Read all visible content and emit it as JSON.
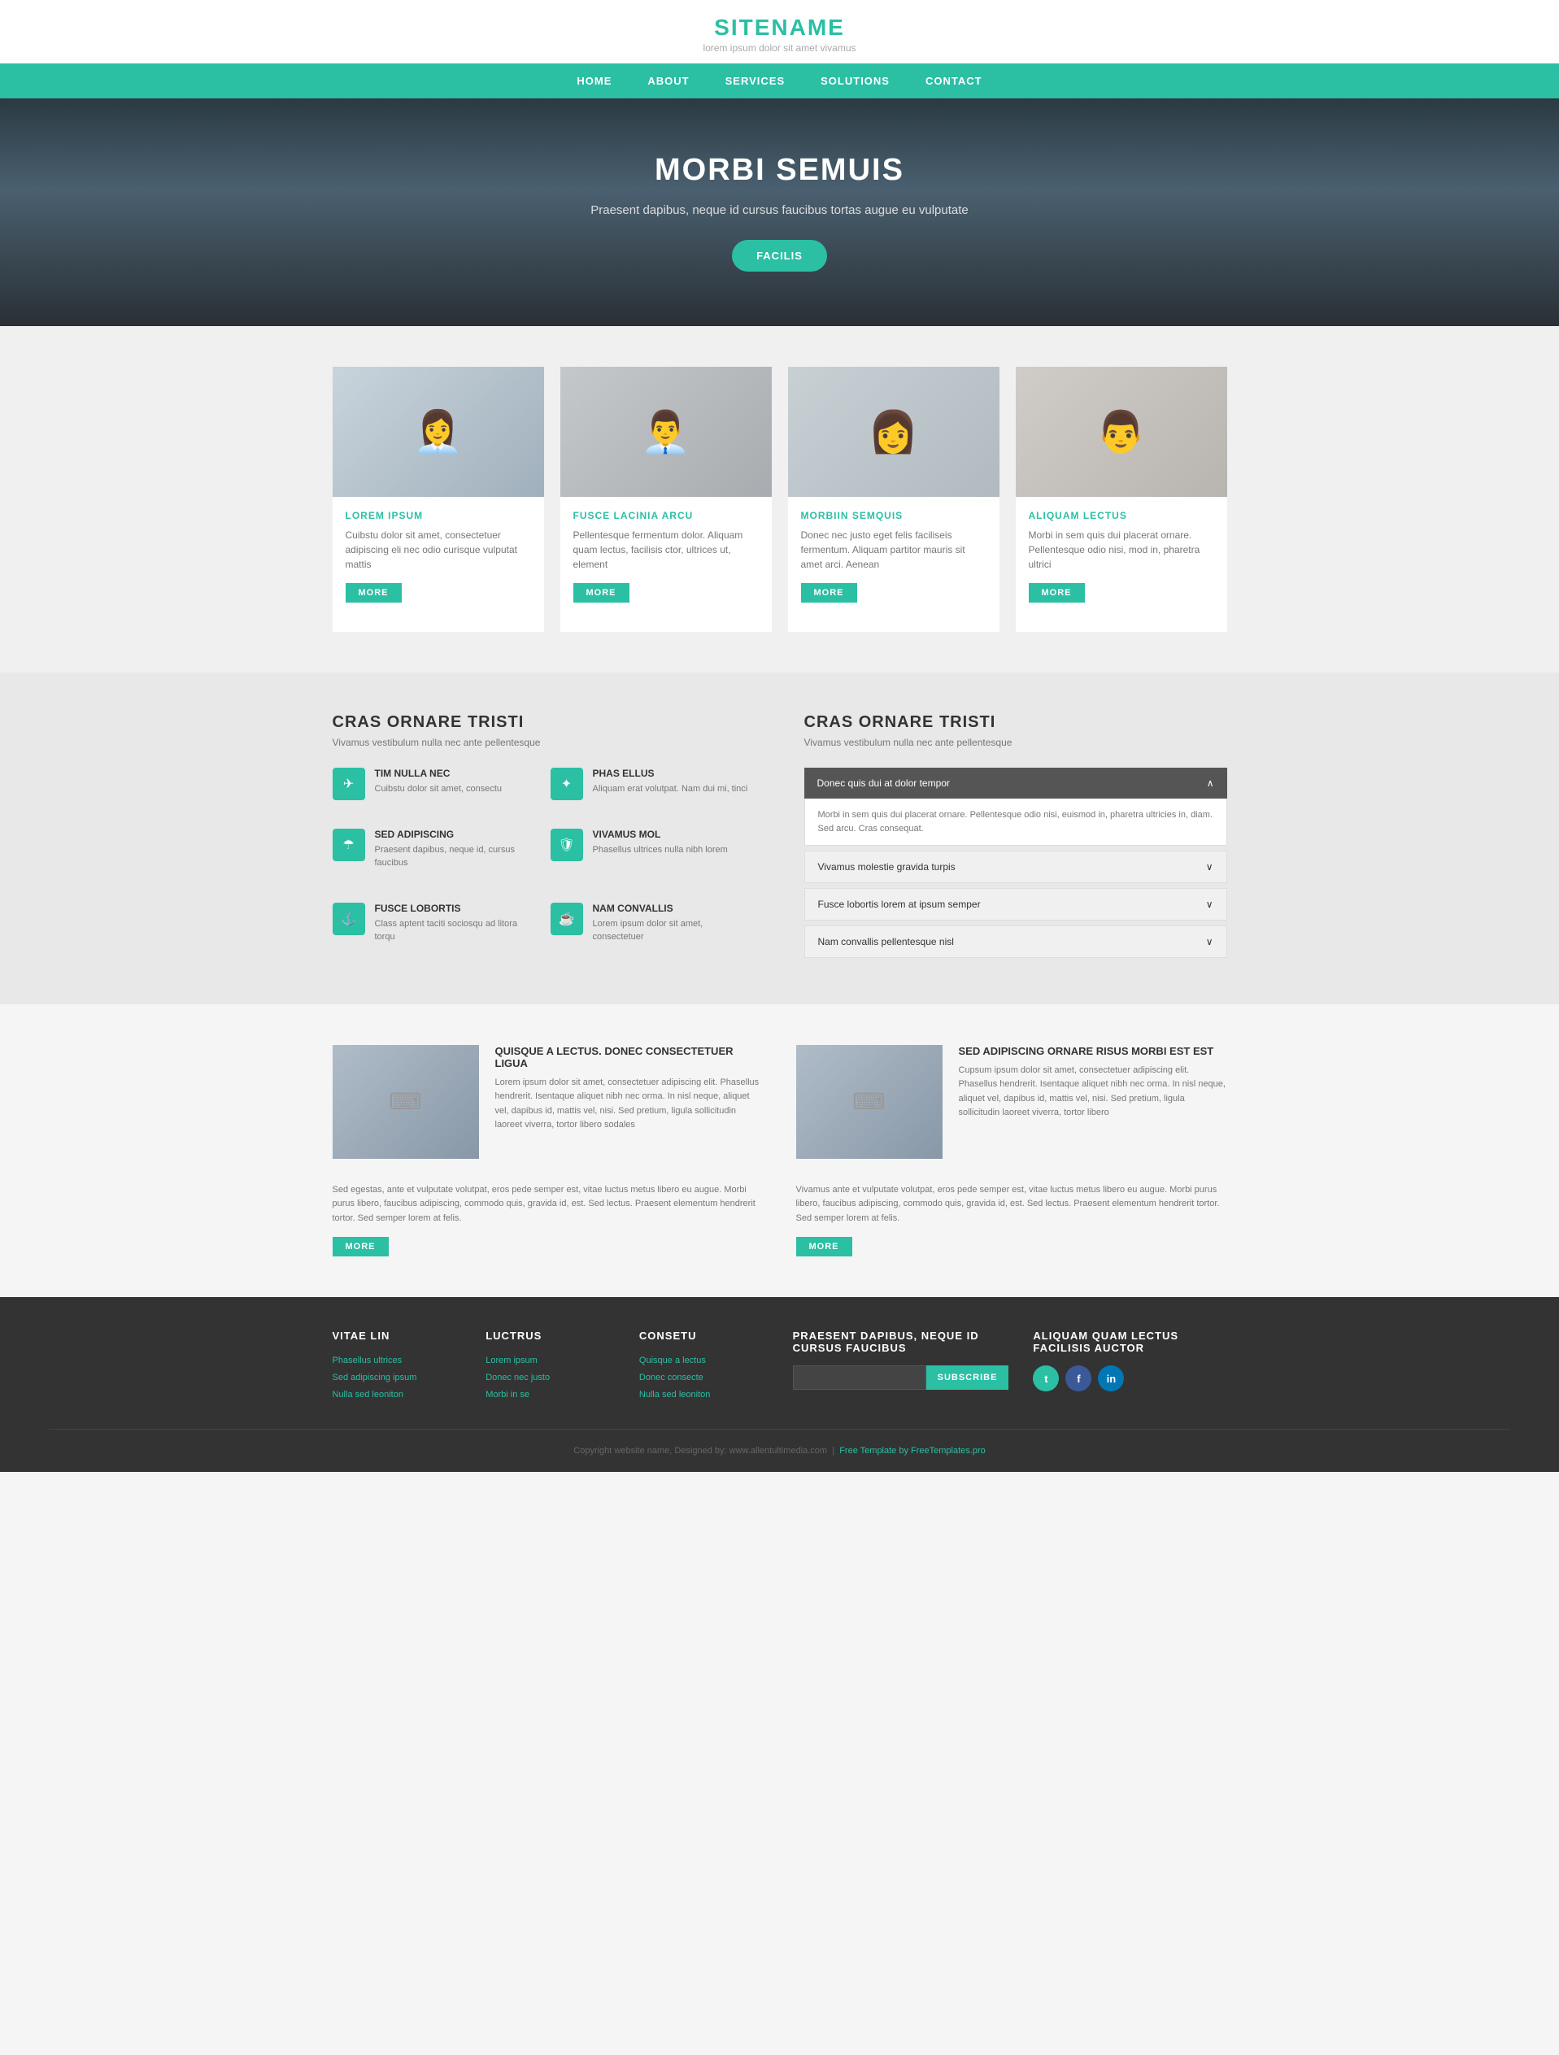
{
  "header": {
    "title": "SITENAME",
    "tagline": "lorem ipsum dolor sit amet vivamus"
  },
  "nav": {
    "items": [
      {
        "label": "HOME",
        "href": "#"
      },
      {
        "label": "ABOUT",
        "href": "#"
      },
      {
        "label": "SERVICES",
        "href": "#"
      },
      {
        "label": "SOLUTIONS",
        "href": "#"
      },
      {
        "label": "CONTACT",
        "href": "#"
      }
    ]
  },
  "hero": {
    "heading": "MORBI SEMUIS",
    "subtext": "Praesent dapibus, neque id cursus faucibus tortas augue eu vulputate",
    "button_label": "FACILIS"
  },
  "cards": {
    "items": [
      {
        "title": "LOREM IPSUM",
        "text": "Cuibstu dolor sit amet, consectetuer adipiscing eli nec odio curisque vulputat mattis",
        "button": "MORE"
      },
      {
        "title": "FUSCE LACINIA ARCU",
        "text": "Pellentesque fermentum dolor. Aliquam quam lectus, facilisis ctor, ultrices ut, element",
        "button": "MORE"
      },
      {
        "title": "MORBIIN SEMQUIS",
        "text": "Donec nec justo eget felis faciliseis fermentum. Aliquam partitor mauris sit amet arci. Aenean",
        "button": "MORE"
      },
      {
        "title": "ALIQUAM LECTUS",
        "text": "Morbi in sem quis dui placerat ornare. Pellentesque odio nisi, mod in, pharetra ultrici",
        "button": "MORE"
      }
    ]
  },
  "features": {
    "left": {
      "heading": "CRAS ORNARE TRISTI",
      "subtext": "Vivamus vestibulum nulla nec ante pellentesque",
      "items": [
        {
          "icon": "✈",
          "title": "TIM NULLA NEC",
          "text": "Cuibstu dolor sit amet, consectu"
        },
        {
          "icon": "✦",
          "title": "PHAS ELLUS",
          "text": "Aliquam erat volutpat. Nam dui mi, tinci"
        },
        {
          "icon": "☂",
          "title": "SED ADIPISCING",
          "text": "Praesent dapibus, neque id, cursus faucibus"
        },
        {
          "icon": "🛡",
          "title": "VIVAMUS MOL",
          "text": "Phasellus ultrices nulla nibh lorem"
        },
        {
          "icon": "⚓",
          "title": "FUSCE LOBORTIS",
          "text": "Class aptent taciti sociosqu ad litora torqu"
        },
        {
          "icon": "☕",
          "title": "NAM CONVALLIS",
          "text": "Lorem ipsum dolor sit amet, consectetuer"
        }
      ]
    },
    "right": {
      "heading": "CRAS ORNARE TRISTI",
      "subtext": "Vivamus vestibulum nulla nec ante pellentesque",
      "accordion": [
        {
          "title": "Donec quis dui at dolor tempor",
          "body": "Morbi in sem quis dui placerat ornare. Pellentesque odio nisi, euismod in, pharetra ultricies in, diam. Sed arcu. Cras consequat.",
          "open": true
        },
        {
          "title": "Vivamus molestie gravida turpis",
          "body": "",
          "open": false
        },
        {
          "title": "Fusce lobortis lorem at ipsum semper",
          "body": "",
          "open": false
        },
        {
          "title": "Nam convallis pellentesque nisl",
          "body": "",
          "open": false
        }
      ]
    }
  },
  "content": {
    "blocks": [
      {
        "title": "QUISQUE A LECTUS. DONEC CONSECTETUER LIGUA",
        "text": "Lorem ipsum dolor sit amet, consectetuer adipiscing elit. Phasellus hendrerit. Isentaque aliquet nibh nec orma. In nisl neque, aliquet vel, dapibus id, mattis vel, nisi. Sed pretium, ligula sollicitudin laoreet viverra, tortor libero sodales"
      },
      {
        "title": "SED ADIPISCING ORNARE RISUS MORBI EST EST",
        "text": "Cupsum ipsum dolor sit amet, consectetuer adipiscing elit. Phasellus hendrerit. Isentaque aliquet nibh nec orma. In nisl neque, aliquet vel, dapibus id, mattis vel, nisi. Sed pretium, ligula sollicitudin laoreet viverra, tortor libero"
      }
    ],
    "bottom_left": "Sed egestas, ante et vulputate volutpat, eros pede semper est, vitae luctus metus libero eu augue. Morbi purus libero, faucibus adipiscing, commodo quis, gravida id, est. Sed lectus. Praesent elementum hendrerit tortor. Sed semper lorem at felis.",
    "bottom_right": "Vivamus ante et vulputate volutpat, eros pede semper est, vitae luctus metus libero eu augue. Morbi purus libero, faucibus adipiscing, commodo quis, gravida id, est. Sed lectus. Praesent elementum hendrerit tortor. Sed semper lorem at felis.",
    "left_button": "MORE",
    "right_button": "MORE"
  },
  "footer": {
    "cols": [
      {
        "heading": "VITAE LIN",
        "links": [
          "Phasellus ultrices",
          "Sed adipiscing ipsum",
          "Nulla sed leoniton"
        ]
      },
      {
        "heading": "LUCTRUS",
        "links": [
          "Lorem ipsum",
          "Donec nec justo",
          "Morbi in se"
        ]
      },
      {
        "heading": "CONSETU",
        "links": [
          "Quisque a lectus",
          "Donec consecte",
          "Nulla sed leoniton"
        ]
      },
      {
        "heading": "PRAESENT DAPIBUS, NEQUE ID CURSUS FAUCIBUS",
        "input_placeholder": "",
        "subscribe_label": "SUBSCRIBE"
      },
      {
        "heading": "ALIQUAM QUAM LECTUS FACILISIS AUCTOR"
      }
    ],
    "bottom": "Copyright website name, Designed by: www.allentultimedia.com",
    "bottom_link": "Free Template by FreeTemplates.pro"
  }
}
